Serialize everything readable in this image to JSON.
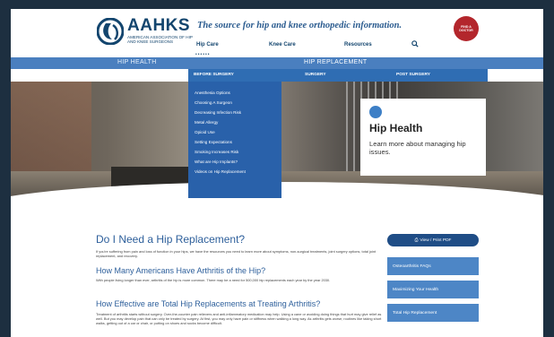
{
  "header": {
    "logo_name": "AAHKS",
    "logo_sub": "AMERICAN ASSOCIATION OF HIP AND KNEE SURGEONS",
    "tagline": "The source for hip and knee orthopedic information.",
    "find_badge": "FIND A DOCTOR"
  },
  "topnav": {
    "hip": "Hip Care",
    "knee": "Knee Care",
    "resources": "Resources"
  },
  "menubar": {
    "hip_health": "HIP HEALTH",
    "hip_replacement": "HIP REPLACEMENT"
  },
  "menu_columns": {
    "before": "BEFORE SURGERY",
    "surgery": "SURGERY",
    "post": "POST SURGERY"
  },
  "dropdown": [
    "Anesthesia Options",
    "Choosing A Surgeon",
    "Decreasing Infection Risk",
    "Metal Allergy",
    "Opioid Use",
    "Setting Expectations",
    "Smoking Increases Risk",
    "What are Hip Implants?",
    "Videos on Hip Replacement"
  ],
  "hero_card": {
    "title": "Hip Health",
    "subtitle": "Learn more about managing hip issues."
  },
  "article": {
    "title": "Do I Need a Hip Replacement?",
    "intro": "If you're suffering from pain and loss of function in your hips, we have the resources you need to learn more about symptoms, non-surgical treatments, joint surgery options, total joint replacement, and recovery.",
    "h2a": "How Many Americans Have Arthritis of the Hip?",
    "pa": "With people living longer than ever, arthritis of the hip is more common. There may be a need for 500,000 hip replacements each year by the year 2030.",
    "h2b": "How Effective are Total Hip Replacements at Treating Arthritis?",
    "pb": "Treatment of arthritis starts without surgery. Over-the-counter pain relievers and anti-inflammatory medication may help. Using a cane or avoiding doing things that hurt may give relief as well. But you may develop pain that can only be treated by surgery. At first, you may only have pain or stiffness when walking a long way. As arthritis gets worse, routines like taking short walks, getting out of a car or chair, or putting on shoes and socks become difficult."
  },
  "sidebar": {
    "pdf": "View / Print PDF",
    "links": [
      "Osteoarthritis FAQs",
      "Maximizing Your Health",
      "Total Hip Replacement"
    ]
  },
  "colors": {
    "navy": "#13456e",
    "menu": "#4a7fbf",
    "dropdown": "#2961aa",
    "link": "#4d86c6",
    "badge": "#b3262c"
  }
}
